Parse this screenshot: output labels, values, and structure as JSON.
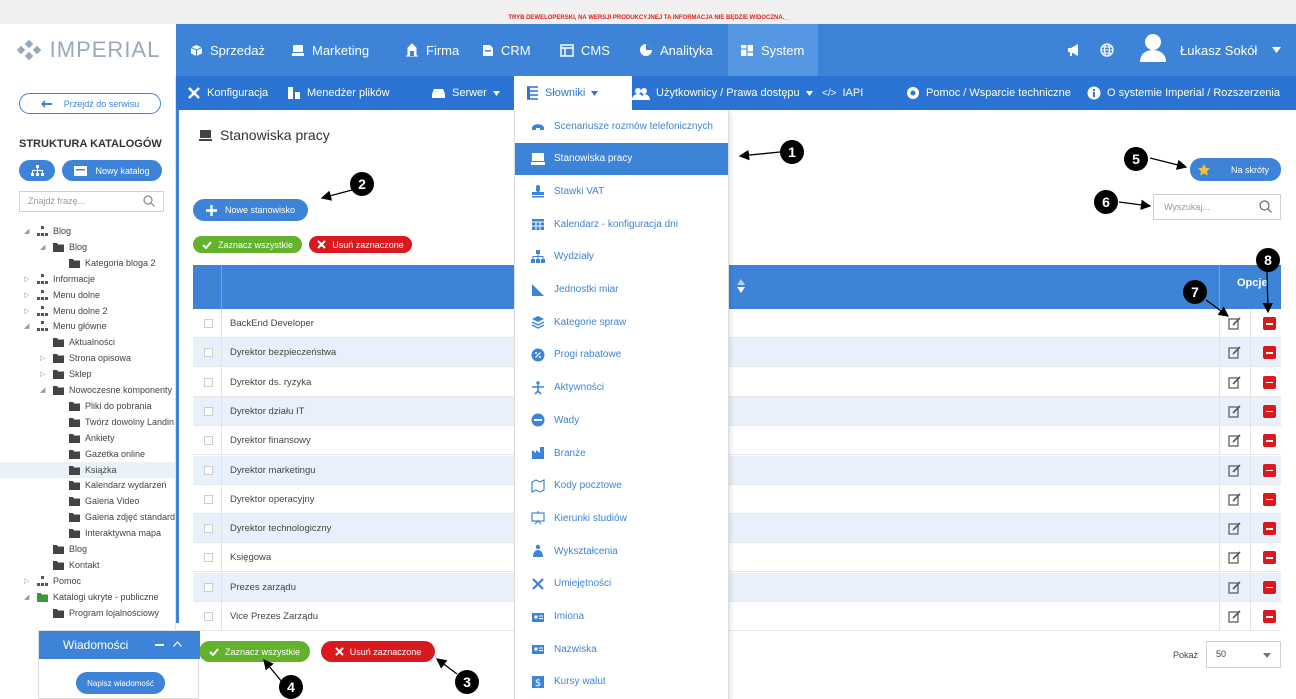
{
  "dev_banner": "TRYB DEWELOPERSKI, NA WERSJI PRODUKCYJNEJ TA INFORMACJA NIE BĘDZIE WIDOCZNA._",
  "logo": "IMPERIAL",
  "topnav": [
    {
      "label": "Sprzedaż",
      "icon": "box-icon"
    },
    {
      "label": "Marketing",
      "icon": "megaphone-icon"
    },
    {
      "label": "Firma",
      "icon": "building-icon"
    },
    {
      "label": "CRM",
      "icon": "crm-icon"
    },
    {
      "label": "CMS",
      "icon": "cms-icon"
    },
    {
      "label": "Analityka",
      "icon": "pie-icon"
    },
    {
      "label": "System",
      "icon": "system-icon",
      "active": true
    }
  ],
  "user": {
    "name": "Łukasz Sokół"
  },
  "subnav": [
    {
      "label": "Konfiguracja"
    },
    {
      "label": "Menedżer plików"
    },
    {
      "label": "Serwer"
    },
    {
      "label": "Słowniki",
      "active": true
    },
    {
      "label": "Użytkownicy / Prawa dostępu"
    },
    {
      "label": "IAPI"
    },
    {
      "label": "Pomoc / Wsparcie techniczne"
    },
    {
      "label": "O systemie Imperial / Rozszerzenia"
    }
  ],
  "sidebar": {
    "back": "Przejdź do serwisu",
    "title": "STRUKTURA KATALOGÓW",
    "new_catalog": "Nowy katalog",
    "search_placeholder": "Znajdź frazę...",
    "tree": [
      {
        "label": "Blog",
        "level": 0,
        "exp": "◢",
        "icon": "tree"
      },
      {
        "label": "Blog",
        "level": 1,
        "exp": "◢",
        "icon": "folder"
      },
      {
        "label": "Kategoria bloga 2",
        "level": 2,
        "exp": "",
        "icon": "folder"
      },
      {
        "label": "Informacje",
        "level": 0,
        "exp": "▷",
        "icon": "tree"
      },
      {
        "label": "Menu dolne",
        "level": 0,
        "exp": "▷",
        "icon": "tree"
      },
      {
        "label": "Menu dolne 2",
        "level": 0,
        "exp": "▷",
        "icon": "tree"
      },
      {
        "label": "Menu główne",
        "level": 0,
        "exp": "◢",
        "icon": "tree"
      },
      {
        "label": "Aktualności",
        "level": 1,
        "exp": "",
        "icon": "folder"
      },
      {
        "label": "Strona opisowa",
        "level": 1,
        "exp": "▷",
        "icon": "folder"
      },
      {
        "label": "Sklep",
        "level": 1,
        "exp": "▷",
        "icon": "folder"
      },
      {
        "label": "Nowoczesne komponenty",
        "level": 1,
        "exp": "◢",
        "icon": "folder"
      },
      {
        "label": "Pliki do pobrania",
        "level": 2,
        "exp": "",
        "icon": "folder"
      },
      {
        "label": "Twórz dowolny Landin",
        "level": 2,
        "exp": "",
        "icon": "folder"
      },
      {
        "label": "Ankiety",
        "level": 2,
        "exp": "",
        "icon": "folder"
      },
      {
        "label": "Gazetka online",
        "level": 2,
        "exp": "",
        "icon": "folder"
      },
      {
        "label": "Książka",
        "level": 2,
        "exp": "",
        "icon": "folder",
        "selected": true
      },
      {
        "label": "Kalendarz wydarzeń",
        "level": 2,
        "exp": "",
        "icon": "folder"
      },
      {
        "label": "Galeria Video",
        "level": 2,
        "exp": "",
        "icon": "folder"
      },
      {
        "label": "Galeria zdjęć standard",
        "level": 2,
        "exp": "",
        "icon": "folder"
      },
      {
        "label": "Interaktywna mapa",
        "level": 2,
        "exp": "",
        "icon": "folder"
      },
      {
        "label": "Blog",
        "level": 1,
        "exp": "",
        "icon": "folder"
      },
      {
        "label": "Kontakt",
        "level": 1,
        "exp": "",
        "icon": "folder"
      },
      {
        "label": "Pomoc",
        "level": 0,
        "exp": "▷",
        "icon": "tree"
      },
      {
        "label": "Katalogi ukryte - publiczne",
        "level": 0,
        "exp": "◢",
        "icon": "folder-green"
      },
      {
        "label": "Program lojalnościowy",
        "level": 1,
        "exp": "",
        "icon": "folder"
      }
    ]
  },
  "main": {
    "title": "Stanowiska pracy",
    "new_button": "Nowe stanowisko",
    "select_all": "Zaznacz wszystkie",
    "delete_selected": "Usuń zaznaczone",
    "shortcuts": "Na skróty",
    "search_placeholder": "Wyszukaj...",
    "options_header": "Opcje",
    "rows": [
      "BackEnd Developer",
      "Dyrektor bezpieczeństwa",
      "Dyrektor ds. ryzyka",
      "Dyrektor działu IT",
      "Dyrektor finansowy",
      "Dyrektor marketingu",
      "Dyrektor operacyjny",
      "Dyrektor technologiczny",
      "Księgowa",
      "Prezes zarządu",
      "Vice Prezes Zarządu"
    ],
    "show_label": "Pokaż",
    "page_size": "50"
  },
  "dropdown": [
    {
      "label": "Scenariusze rozmów telefonicznych",
      "icon": "phone-icon"
    },
    {
      "label": "Stanowiska pracy",
      "icon": "workstation-icon",
      "active": true
    },
    {
      "label": "Stawki VAT",
      "icon": "stamp-icon"
    },
    {
      "label": "Kalendarz - konfiguracja dni",
      "icon": "calendar-icon"
    },
    {
      "label": "Wydziały",
      "icon": "sitemap-icon"
    },
    {
      "label": "Jednostki miar",
      "icon": "ruler-icon"
    },
    {
      "label": "Kategorie spraw",
      "icon": "layers-icon"
    },
    {
      "label": "Progi rabatowe",
      "icon": "percent-icon"
    },
    {
      "label": "Aktywności",
      "icon": "activity-icon"
    },
    {
      "label": "Wady",
      "icon": "minus-circle-icon"
    },
    {
      "label": "Branże",
      "icon": "industry-icon"
    },
    {
      "label": "Kody pocztowe",
      "icon": "map-icon"
    },
    {
      "label": "Kierunki studiów",
      "icon": "board-icon"
    },
    {
      "label": "Wykształcenia",
      "icon": "education-icon"
    },
    {
      "label": "Umiejętności",
      "icon": "tools-icon"
    },
    {
      "label": "Imiona",
      "icon": "id-icon"
    },
    {
      "label": "Nazwiska",
      "icon": "id-icon"
    },
    {
      "label": "Kursy walut",
      "icon": "dollar-icon"
    }
  ],
  "messages": {
    "title": "Wiadomości",
    "write": "Napisz wiadomość"
  },
  "callouts": [
    "1",
    "2",
    "3",
    "4",
    "5",
    "6",
    "7",
    "8"
  ],
  "colors": {
    "primary": "#3d84d8",
    "green": "#63b22e",
    "red": "#d9191e"
  }
}
